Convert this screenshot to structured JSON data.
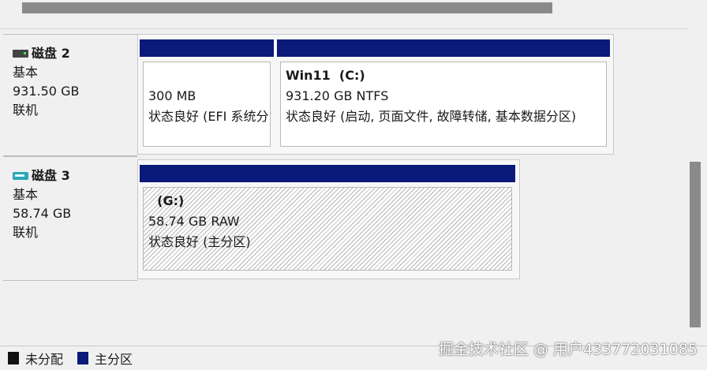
{
  "disks": [
    {
      "name": "磁盘 2",
      "type": "基本",
      "size": "931.50 GB",
      "status": "联机",
      "icon": "hdd-icon",
      "partitions": [
        {
          "title": "",
          "size": "300 MB",
          "health": "状态良好 (EFI 系统分区)"
        },
        {
          "title": "Win11  (C:)",
          "size": "931.20 GB NTFS",
          "health": "状态良好 (启动, 页面文件, 故障转储, 基本数据分区)"
        }
      ]
    },
    {
      "name": "磁盘 3",
      "type": "基本",
      "size": "58.74 GB",
      "status": "联机",
      "icon": "usb-drive-icon",
      "partitions": [
        {
          "title": "  (G:)",
          "size": "58.74 GB RAW",
          "health": "状态良好 (主分区)"
        }
      ]
    }
  ],
  "legend": [
    {
      "label": "未分配",
      "color": "#111111"
    },
    {
      "label": "主分区",
      "color": "#0a1a7a"
    }
  ],
  "watermark": "掘金技术社区 @ 用户433772031085",
  "colors": {
    "primary_partition": "#0a1a7a",
    "unallocated": "#111111"
  }
}
